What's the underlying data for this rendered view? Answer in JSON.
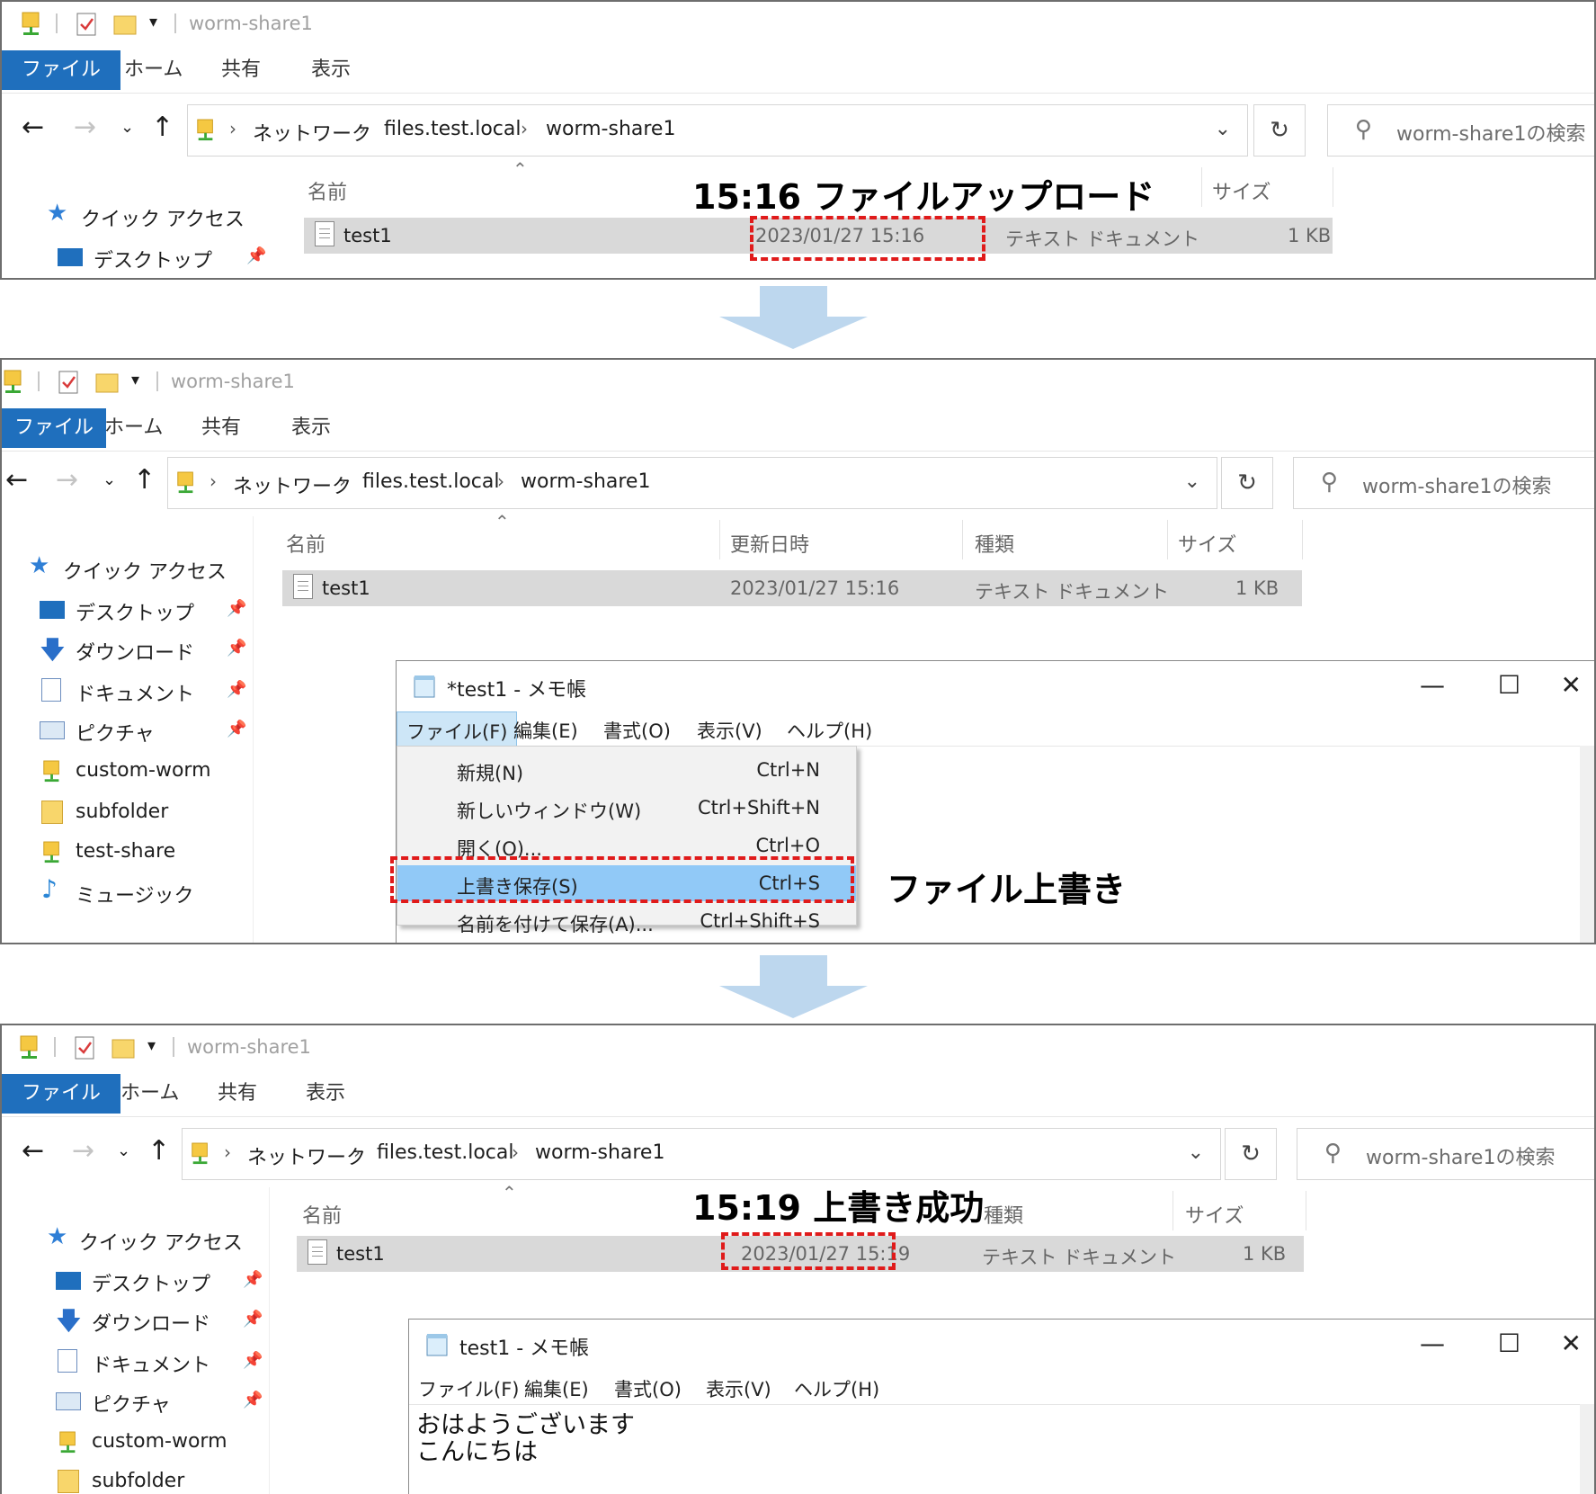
{
  "explorer": {
    "title": "worm-share1",
    "ribbon_tabs": [
      "ファイル",
      "ホーム",
      "共有",
      "表示"
    ],
    "breadcrumb": [
      "ネットワーク",
      "files.test.local",
      "worm-share1"
    ],
    "search_placeholder": "worm-share1の検索",
    "columns": {
      "name": "名前",
      "modified": "更新日時",
      "type": "種類",
      "size": "サイズ"
    },
    "nav": {
      "quick_access": "クイック アクセス",
      "desktop": "デスクトップ",
      "downloads": "ダウンロード",
      "documents": "ドキュメント",
      "pictures": "ピクチャ",
      "custom_worm": "custom-worm",
      "subfolder": "subfolder",
      "test_share": "test-share",
      "music": "ミュージック"
    }
  },
  "step1": {
    "annotation": "15:16 ファイルアップロード",
    "file": {
      "name": "test1",
      "modified": "2023/01/27 15:16",
      "type": "テキスト ドキュメント",
      "size": "1 KB"
    }
  },
  "step2": {
    "file": {
      "name": "test1",
      "modified": "2023/01/27 15:16",
      "type": "テキスト ドキュメント",
      "size": "1 KB"
    },
    "notepad_title": "*test1 - メモ帳",
    "menus": [
      "ファイル(F)",
      "編集(E)",
      "書式(O)",
      "表示(V)",
      "ヘルプ(H)"
    ],
    "file_menu": [
      {
        "label": "新規(N)",
        "shortcut": "Ctrl+N"
      },
      {
        "label": "新しいウィンドウ(W)",
        "shortcut": "Ctrl+Shift+N"
      },
      {
        "label": "開く(O)...",
        "shortcut": "Ctrl+O"
      },
      {
        "label": "上書き保存(S)",
        "shortcut": "Ctrl+S"
      },
      {
        "label": "名前を付けて保存(A)...",
        "shortcut": "Ctrl+Shift+S"
      }
    ],
    "annotation": "ファイル上書き"
  },
  "step3": {
    "annotation": "15:19 上書き成功",
    "file": {
      "name": "test1",
      "modified": "2023/01/27 15:19",
      "type": "テキスト ドキュメント",
      "size": "1 KB"
    },
    "notepad_title": "test1 - メモ帳",
    "menus": [
      "ファイル(F)",
      "編集(E)",
      "書式(O)",
      "表示(V)",
      "ヘルプ(H)"
    ],
    "content": [
      "おはようございます",
      "こんにちは"
    ]
  },
  "window_controls": {
    "minimize": "—",
    "maximize": "☐",
    "close": "✕"
  },
  "colors": {
    "ribbon_file_tab": "#1f6fbd",
    "highlight_box": "#e01b1b",
    "flow_arrow": "#bdd7ee",
    "menu_highlight": "#91c9f7"
  }
}
